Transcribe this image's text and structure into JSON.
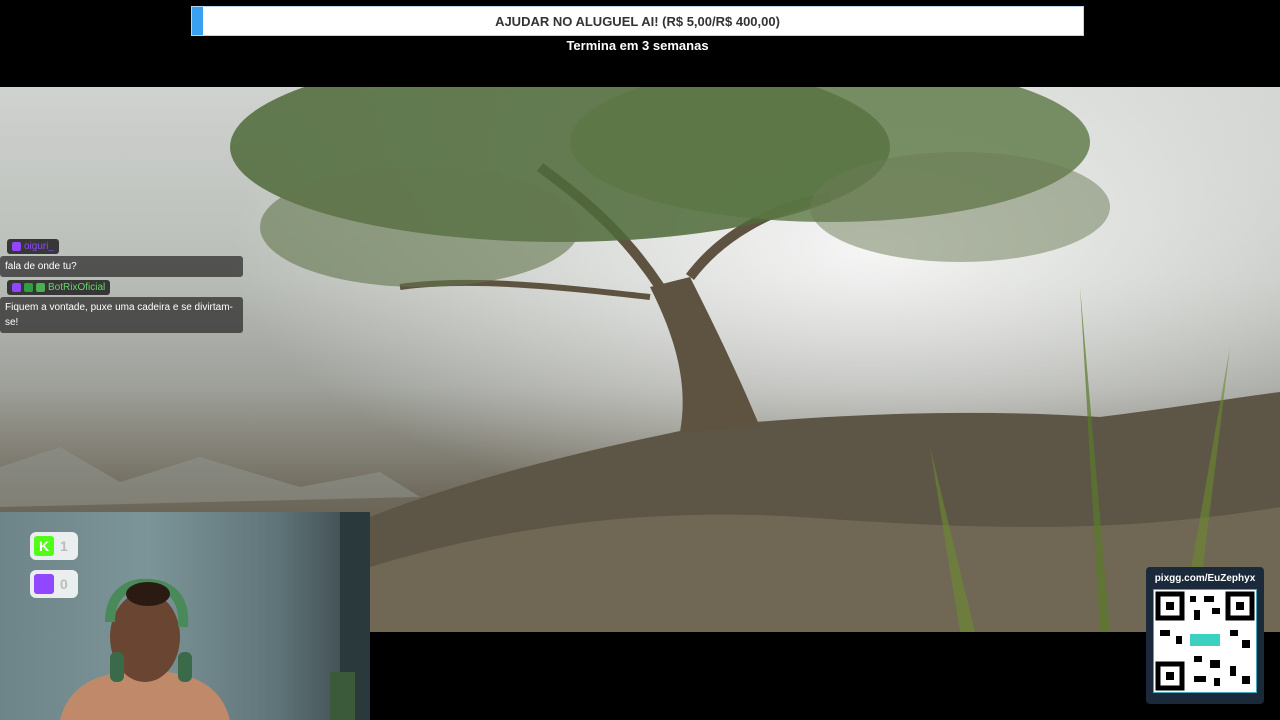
{
  "goal": {
    "title": "AJUDAR NO ALUGUEL AI! (R$ 5,00/R$ 400,00)",
    "subtitle": "Termina em 3 semanas",
    "progress_fraction": 0.0125,
    "fill_color": "#3aa0f0"
  },
  "chat": {
    "messages": [
      {
        "user": "oiguri_",
        "user_color": "#9146ff",
        "text": "fala de onde tu?",
        "badges": [
          "twitch-badge"
        ]
      },
      {
        "user": "BotRixOficial",
        "user_color": "#6cd36c",
        "text": "Fiquem a vontade, puxe uma cadeira e se divirtam-se!",
        "badges": [
          "twitch-badge",
          "verified-badge",
          "bot-badge"
        ]
      }
    ]
  },
  "socials": [
    {
      "icon": "kick-icon",
      "count": "1",
      "color": "#53fc18"
    },
    {
      "icon": "twitch-icon",
      "count": "0",
      "color": "#9146ff"
    }
  ],
  "pix": {
    "url": "pixgg.com/EuZephyx"
  }
}
